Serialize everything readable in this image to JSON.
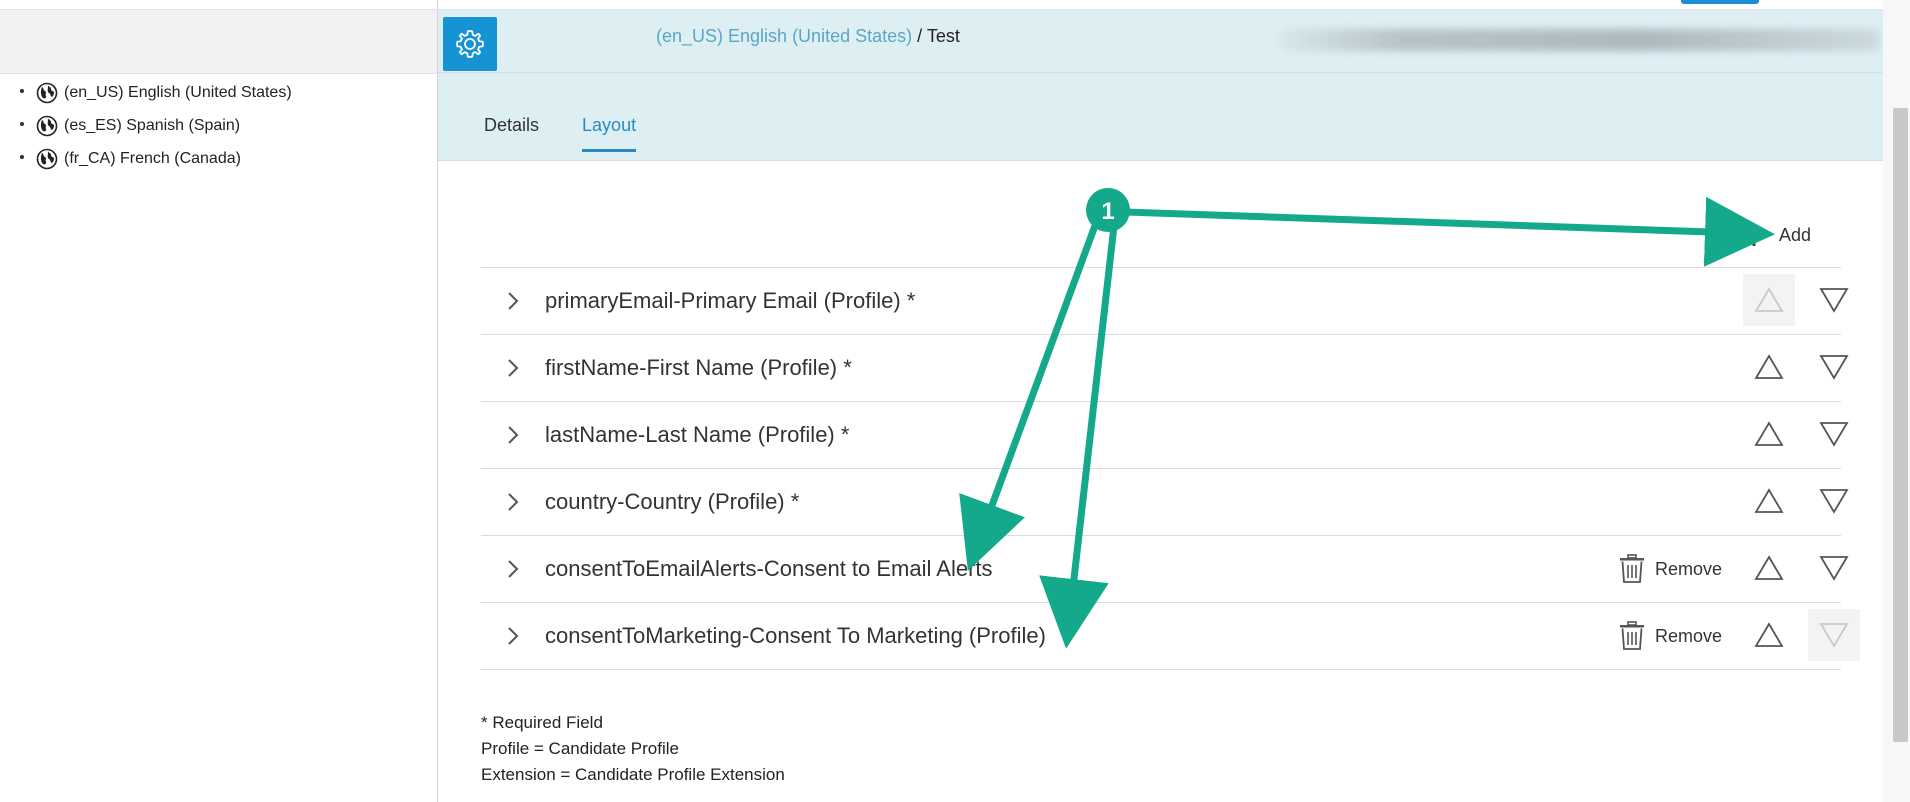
{
  "locales": [
    {
      "label": "(en_US) English (United States)"
    },
    {
      "label": "(es_ES) Spanish (Spain)"
    },
    {
      "label": "(fr_CA) French (Canada)"
    }
  ],
  "breadcrumb": {
    "link": "(en_US) English (United States)",
    "separator": " / ",
    "current": "Test"
  },
  "tabs": [
    {
      "label": "Details",
      "active": false
    },
    {
      "label": "Layout",
      "active": true
    }
  ],
  "add_label": "Add",
  "rows": [
    {
      "label": "primaryEmail-Primary Email (Profile)  *",
      "remove": false,
      "up_disabled": true,
      "down_disabled": false
    },
    {
      "label": "firstName-First Name (Profile)  *",
      "remove": false,
      "up_disabled": false,
      "down_disabled": false
    },
    {
      "label": "lastName-Last Name (Profile)  *",
      "remove": false,
      "up_disabled": false,
      "down_disabled": false
    },
    {
      "label": "country-Country (Profile)  *",
      "remove": false,
      "up_disabled": false,
      "down_disabled": false
    },
    {
      "label": "consentToEmailAlerts-Consent to Email Alerts",
      "remove": true,
      "up_disabled": false,
      "down_disabled": false
    },
    {
      "label": "consentToMarketing-Consent To Marketing (Profile)",
      "remove": true,
      "up_disabled": false,
      "down_disabled": true
    }
  ],
  "remove_label": "Remove",
  "legend": {
    "line1": "* Required Field",
    "line2": "Profile = Candidate Profile",
    "line3": "Extension = Candidate Profile Extension"
  },
  "annotation": {
    "number": "1",
    "color": "#13a98a"
  },
  "colors": {
    "accent": "#1593d2",
    "header_bg": "#deeff4",
    "tab_active": "#2a8ac0"
  },
  "icons": [
    "globe-icon",
    "gear-icon",
    "plus-icon",
    "chevron-right-icon",
    "trash-icon",
    "triangle-up-icon",
    "triangle-down-icon"
  ]
}
